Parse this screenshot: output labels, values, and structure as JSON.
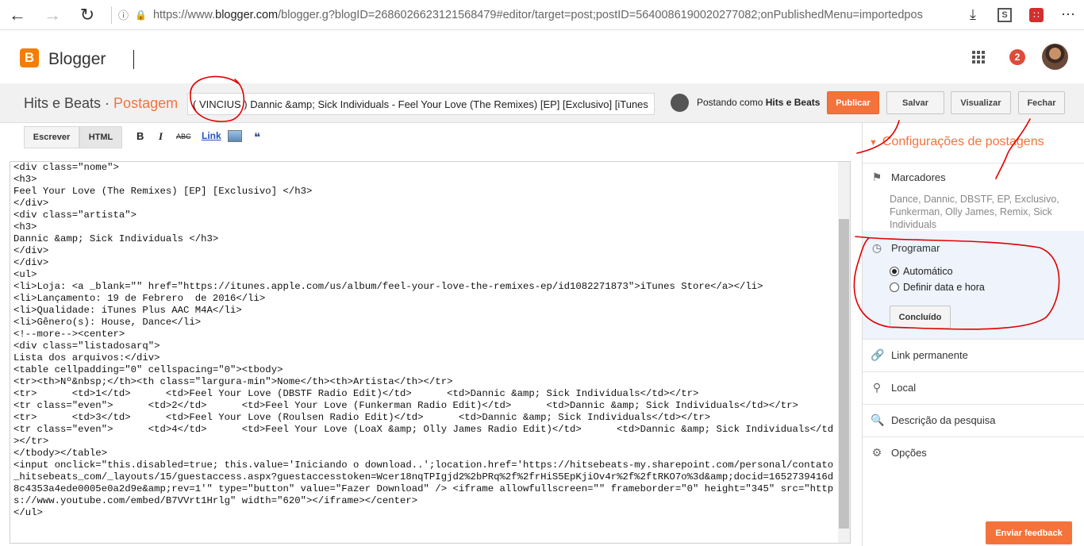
{
  "browser": {
    "url_prefix": "https://www.",
    "url_host": "blogger.com",
    "url_rest": "/blogger.g?blogID=2686026623121568479#editor/target=post;postID=5640086190020277082;onPublishedMenu=importedpos"
  },
  "header": {
    "logo_letter": "B",
    "app_name": "Blogger",
    "notifications": "2"
  },
  "post": {
    "blog_name": "Hits e Beats",
    "section": "Postagem",
    "title": "( VINCIUS ) Dannic &amp; Sick Individuals - Feel Your Love (The Remixes) [EP] [Exclusivo] [iTunes",
    "posting_as_prefix": "Postando como ",
    "posting_as_name": "Hits e Beats",
    "buttons": {
      "publish": "Publicar",
      "save": "Salvar",
      "preview": "Visualizar",
      "close": "Fechar"
    }
  },
  "toolbar": {
    "compose": "Escrever",
    "html": "HTML",
    "bold": "B",
    "italic": "I",
    "strike": "ABC",
    "link": "Link",
    "quote": "❝"
  },
  "code_lines": [
    "<div class=\"nome\">",
    "<h3>",
    "Feel Your Love (The Remixes) [EP] [Exclusivo] </h3>",
    "</div>",
    "<div class=\"artista\">",
    "<h3>",
    "Dannic &amp; Sick Individuals </h3>",
    "</div>",
    "</div>",
    "<ul>",
    "<li>Loja: <a _blank=\"\" href=\"https://itunes.apple.com/us/album/feel-your-love-the-remixes-ep/id1082271873\">iTunes Store</a></li>",
    "<li>Lançamento: 19 de Febrero  de 2016</li>",
    "<li>Qualidade: iTunes Plus AAC M4A</li>",
    "<li>Gênero(s): House, Dance</li>",
    "<!--more--><center>",
    "<div class=\"listadosarq\">",
    "Lista dos arquivos:</div>",
    "<table cellpadding=\"0\" cellspacing=\"0\"><tbody>",
    "<tr><th>Nº&nbsp;</th><th class=\"largura-min\">Nome</th><th>Artista</th></tr>",
    "<tr>      <td>1</td>      <td>Feel Your Love (DBSTF Radio Edit)</td>      <td>Dannic &amp; Sick Individuals</td></tr>",
    "<tr class=\"even\">      <td>2</td>      <td>Feel Your Love (Funkerman Radio Edit)</td>      <td>Dannic &amp; Sick Individuals</td></tr>",
    "<tr>      <td>3</td>      <td>Feel Your Love (Roulsen Radio Edit)</td>      <td>Dannic &amp; Sick Individuals</td></tr>",
    "<tr class=\"even\">      <td>4</td>      <td>Feel Your Love (LoaX &amp; Olly James Radio Edit)</td>      <td>Dannic &amp; Sick Individuals</td></tr>",
    "</tbody></table>",
    "<input onclick=\"this.disabled=true; this.value='Iniciando o download..';location.href='https://hitsebeats-my.sharepoint.com/personal/contato_hitsebeats_com/_layouts/15/guestaccess.aspx?guestaccesstoken=Wcer18nqTPIgjd2%2bPRq%2f%2frHiS5EpKjiOv4r%2f%2ftRKO7o%3d&amp;docid=1652739416d8c4353a4ede0005e0a2d9e&amp;rev=1'\" type=\"button\" value=\"Fazer Download\" /> <iframe allowfullscreen=\"\" frameborder=\"0\" height=\"345\" src=\"https://www.youtube.com/embed/B7VVrt1Hrlg\" width=\"620\"></iframe></center>",
    "</ul>"
  ],
  "sidebar": {
    "heading": "Configurações de postagens",
    "labels_title": "Marcadores",
    "labels_value": "Dance, Dannic, DBSTF, EP, Exclusivo, Funkerman, Olly James, Remix, Sick Individuals",
    "schedule_title": "Programar",
    "schedule_auto": "Automático",
    "schedule_custom": "Definir data e hora",
    "done": "Concluído",
    "permalink": "Link permanente",
    "location": "Local",
    "search_desc": "Descrição da pesquisa",
    "options": "Opções"
  },
  "feedback": "Enviar feedback",
  "colors": {
    "accent": "#f4733b",
    "annotation": "#e00000"
  }
}
